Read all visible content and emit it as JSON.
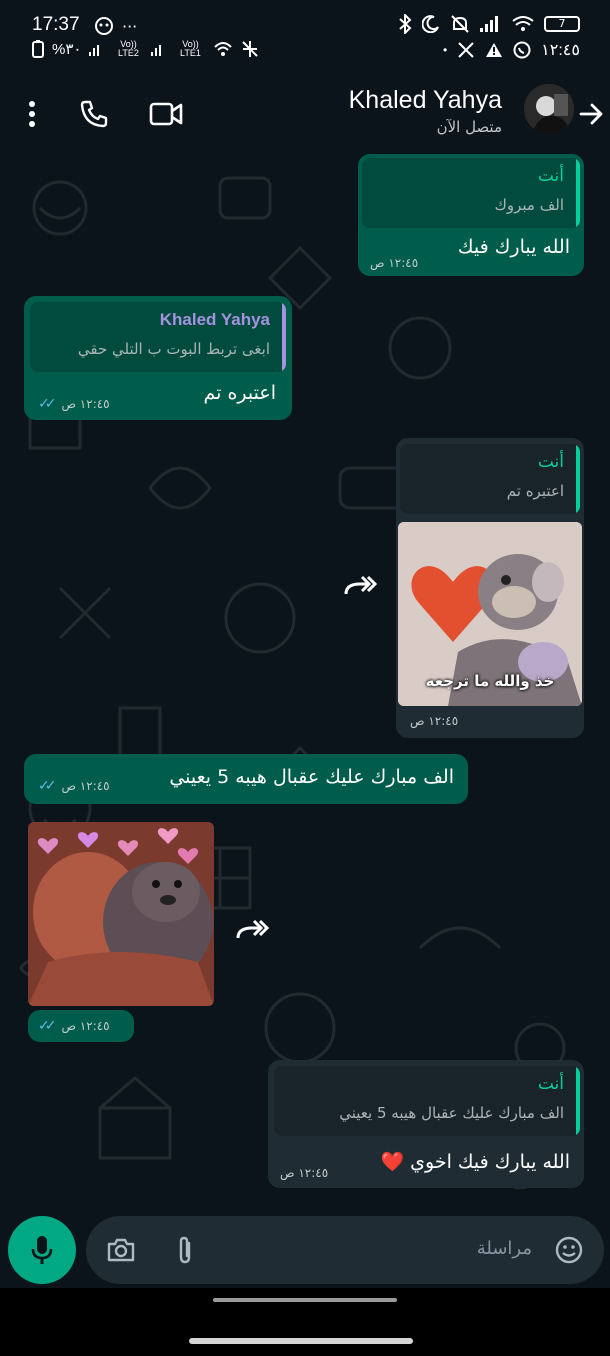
{
  "status_bar": {
    "time": "17:37",
    "battery_text": "%٣٠",
    "battery_level": "7",
    "lte1": "Vo)) LTE2",
    "lte2": "Vo)) LTE1",
    "right_time": "١٢:٤٥"
  },
  "header": {
    "contact_name": "Khaled Yahya",
    "presence": "متصل الآن"
  },
  "messages": [
    {
      "quote_name": "أنت",
      "quote_text": "الف مبروك",
      "text": "الله يبارك فيك",
      "time": "١٢:٤٥ ص"
    },
    {
      "quote_name": "Khaled Yahya",
      "quote_text": "ابغى تربط البوت ب التلي حقي",
      "text": "اعتبره تم",
      "time": "١٢:٤٥ ص"
    },
    {
      "quote_name": "أنت",
      "quote_text": "اعتبره تم",
      "sticker_caption": "خذ والله ما ترجعه",
      "time": "١٢:٤٥ ص"
    },
    {
      "text": "الف مبارك عليك عقبال هيبه 5 يعيني",
      "time": "١٢:٤٥ ص"
    },
    {
      "time": "١٢:٤٥ ص"
    },
    {
      "quote_name": "أنت",
      "quote_text": "الف مبارك عليك عقبال هيبه 5 يعيني",
      "text": "الله يبارك فيك اخوي ❤️",
      "time": "١٢:٤٥ ص"
    }
  ],
  "input": {
    "placeholder": "مراسلة"
  },
  "colors": {
    "background": "#0b141a",
    "outgoing_bubble": "#005c4b",
    "incoming_bubble": "#1f2c34",
    "accent": "#00a884",
    "read_ticks": "#53bdeb"
  }
}
